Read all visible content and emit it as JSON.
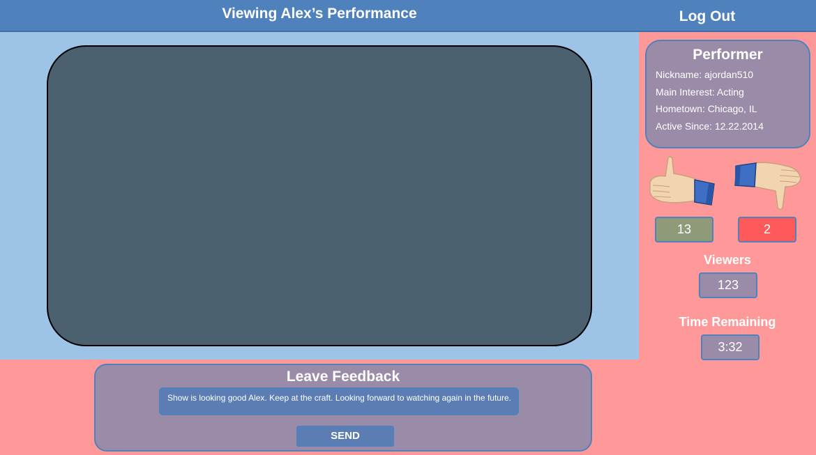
{
  "header": {
    "title": "Viewing Alex’s Performance",
    "logout_label": "Log Out"
  },
  "performer": {
    "heading": "Performer",
    "nickname": "Nickname: ajordan510",
    "main_interest": "Main Interest: Acting",
    "hometown": "Hometown: Chicago, IL",
    "active_since": "Active Since: 12.22.2014"
  },
  "ratings": {
    "thumbs_up_icon": "thumbs-up-icon",
    "thumbs_down_icon": "thumbs-down-icon",
    "likes": "13",
    "dislikes": "2",
    "like_color": "#8e9a78",
    "dislike_color": "#ff5a5a"
  },
  "stats": {
    "viewers_label": "Viewers",
    "viewers_value": "123",
    "time_label": "Time Remaining",
    "time_value": "3:32"
  },
  "feedback": {
    "heading": "Leave Feedback",
    "text": "Show is looking good Alex.  Keep at the craft.  Looking forward to watching again in the future.",
    "send_label": "SEND"
  },
  "colors": {
    "header": "#4f81bd",
    "stage_bg": "#9dc3e6",
    "video": "#4b6170",
    "page_bg": "#ff9999",
    "card": "#9a8ca9"
  }
}
